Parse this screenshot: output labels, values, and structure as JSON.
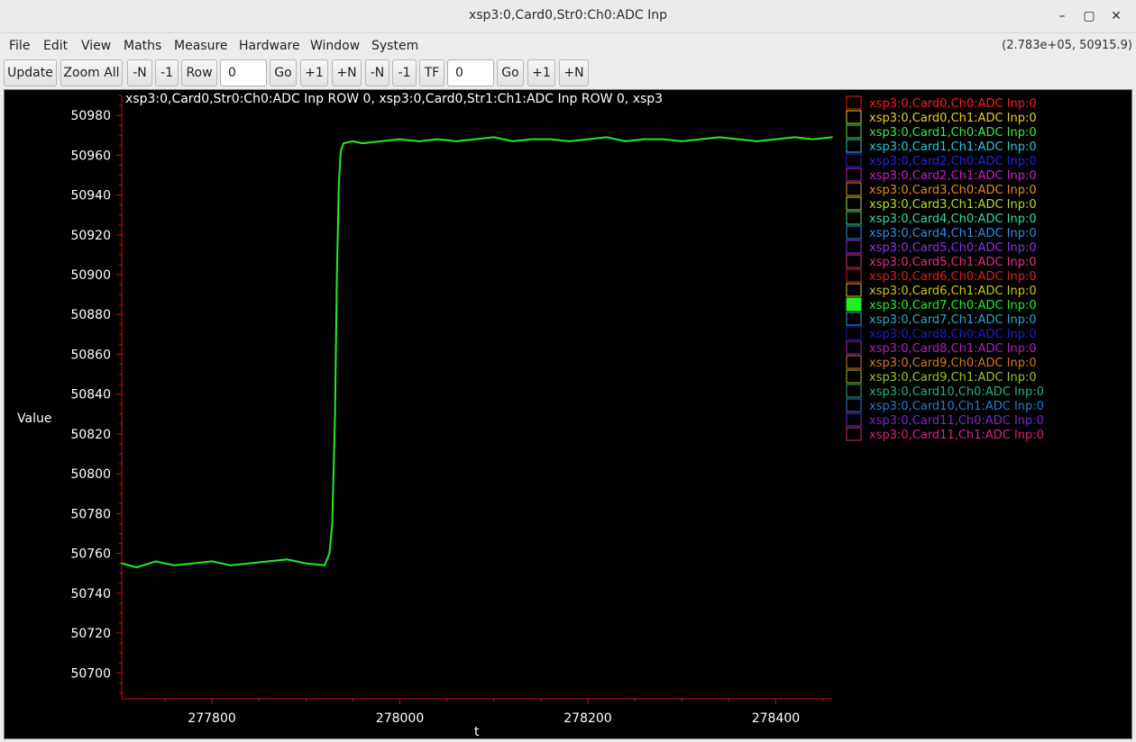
{
  "window": {
    "title": "xsp3:0,Card0,Str0:Ch0:ADC Inp",
    "controls": {
      "minimize": "minimize-icon",
      "maximize": "maximize-icon",
      "close": "close-icon"
    }
  },
  "menu": [
    "File",
    "Edit",
    "View",
    "Maths",
    "Measure",
    "Hardware",
    "Window",
    "System"
  ],
  "cursor_readout": "(2.783e+05,  50915.9)",
  "toolbar": {
    "update": "Update",
    "zoom_all": "Zoom All",
    "row_minus_n": "-N",
    "row_minus_1": "-1",
    "row": "Row",
    "row_value": "0",
    "row_go": "Go",
    "row_plus_1": "+1",
    "row_plus_n": "+N",
    "tf_minus_n": "-N",
    "tf_minus_1": "-1",
    "tf": "TF",
    "tf_value": "0",
    "tf_go": "Go",
    "tf_plus_1": "+1",
    "tf_plus_n": "+N"
  },
  "colors": {
    "background": "#000000",
    "axis": "#d01010",
    "active_trace": "#22ee22"
  },
  "chart_data": {
    "type": "line",
    "title": "xsp3:0,Card0,Str0:Ch0:ADC Inp ROW 0, xsp3:0,Card0,Str1:Ch1:ADC Inp ROW 0, xsp3",
    "xlabel": "t",
    "ylabel": "Value",
    "xlim": [
      277704,
      278460
    ],
    "ylim": [
      50687,
      50990
    ],
    "x_ticks": [
      277800,
      278000,
      278200,
      278400
    ],
    "y_ticks": [
      50700,
      50720,
      50740,
      50760,
      50780,
      50800,
      50820,
      50840,
      50860,
      50880,
      50900,
      50920,
      50940,
      50960,
      50980
    ],
    "grid": false,
    "legend_position": "right",
    "series": [
      {
        "name": "xsp3:0,Card7,Ch0:ADC Inp:0",
        "color": "#22ee22",
        "x": [
          277704,
          277720,
          277740,
          277760,
          277780,
          277800,
          277820,
          277840,
          277860,
          277880,
          277900,
          277920,
          277925,
          277928,
          277931,
          277933,
          277935,
          277937,
          277940,
          277950,
          277960,
          277980,
          278000,
          278020,
          278040,
          278060,
          278080,
          278100,
          278120,
          278140,
          278160,
          278180,
          278200,
          278220,
          278240,
          278260,
          278280,
          278300,
          278320,
          278340,
          278360,
          278380,
          278400,
          278420,
          278440,
          278460
        ],
        "y": [
          50755,
          50753,
          50756,
          50754,
          50755,
          50756,
          50754,
          50755,
          50756,
          50757,
          50755,
          50754,
          50760,
          50775,
          50830,
          50900,
          50945,
          50962,
          50966,
          50967,
          50966,
          50967,
          50968,
          50967,
          50968,
          50967,
          50968,
          50969,
          50967,
          50968,
          50968,
          50967,
          50968,
          50969,
          50967,
          50968,
          50968,
          50967,
          50968,
          50969,
          50968,
          50967,
          50968,
          50969,
          50968,
          50969
        ]
      }
    ]
  },
  "legend": {
    "active_index": 14,
    "items": [
      {
        "label": "xsp3:0,Card0,Ch0:ADC Inp:0",
        "color": "#ff1a1a"
      },
      {
        "label": "xsp3:0,Card0,Ch1:ADC Inp:0",
        "color": "#e6d21a"
      },
      {
        "label": "xsp3:0,Card1,Ch0:ADC Inp:0",
        "color": "#44e644"
      },
      {
        "label": "xsp3:0,Card1,Ch1:ADC Inp:0",
        "color": "#28c8dc"
      },
      {
        "label": "xsp3:0,Card2,Ch0:ADC Inp:0",
        "color": "#2424e6"
      },
      {
        "label": "xsp3:0,Card2,Ch1:ADC Inp:0",
        "color": "#c81ec8"
      },
      {
        "label": "xsp3:0,Card3,Ch0:ADC Inp:0",
        "color": "#e68a1e"
      },
      {
        "label": "xsp3:0,Card3,Ch1:ADC Inp:0",
        "color": "#b8dc28"
      },
      {
        "label": "xsp3:0,Card4,Ch0:ADC Inp:0",
        "color": "#32dc9a"
      },
      {
        "label": "xsp3:0,Card4,Ch1:ADC Inp:0",
        "color": "#2890e6"
      },
      {
        "label": "xsp3:0,Card5,Ch0:ADC Inp:0",
        "color": "#8a32e6"
      },
      {
        "label": "xsp3:0,Card5,Ch1:ADC Inp:0",
        "color": "#e62a8c"
      },
      {
        "label": "xsp3:0,Card6,Ch0:ADC Inp:0",
        "color": "#dc2020"
      },
      {
        "label": "xsp3:0,Card6,Ch1:ADC Inp:0",
        "color": "#c8c820"
      },
      {
        "label": "xsp3:0,Card7,Ch0:ADC Inp:0",
        "color": "#22ee22"
      },
      {
        "label": "xsp3:0,Card7,Ch1:ADC Inp:0",
        "color": "#2aa8c8"
      },
      {
        "label": "xsp3:0,Card8,Ch0:ADC Inp:0",
        "color": "#1e1ec8"
      },
      {
        "label": "xsp3:0,Card8,Ch1:ADC Inp:0",
        "color": "#b41eb4"
      },
      {
        "label": "xsp3:0,Card9,Ch0:ADC Inp:0",
        "color": "#d27a1a"
      },
      {
        "label": "xsp3:0,Card9,Ch1:ADC Inp:0",
        "color": "#9ac81e"
      },
      {
        "label": "xsp3:0,Card10,Ch0:ADC Inp:0",
        "color": "#1eb482"
      },
      {
        "label": "xsp3:0,Card10,Ch1:ADC Inp:0",
        "color": "#2a78d2"
      },
      {
        "label": "xsp3:0,Card11,Ch0:ADC Inp:0",
        "color": "#7a28d2"
      },
      {
        "label": "xsp3:0,Card11,Ch1:ADC Inp:0",
        "color": "#d2287a"
      }
    ]
  }
}
